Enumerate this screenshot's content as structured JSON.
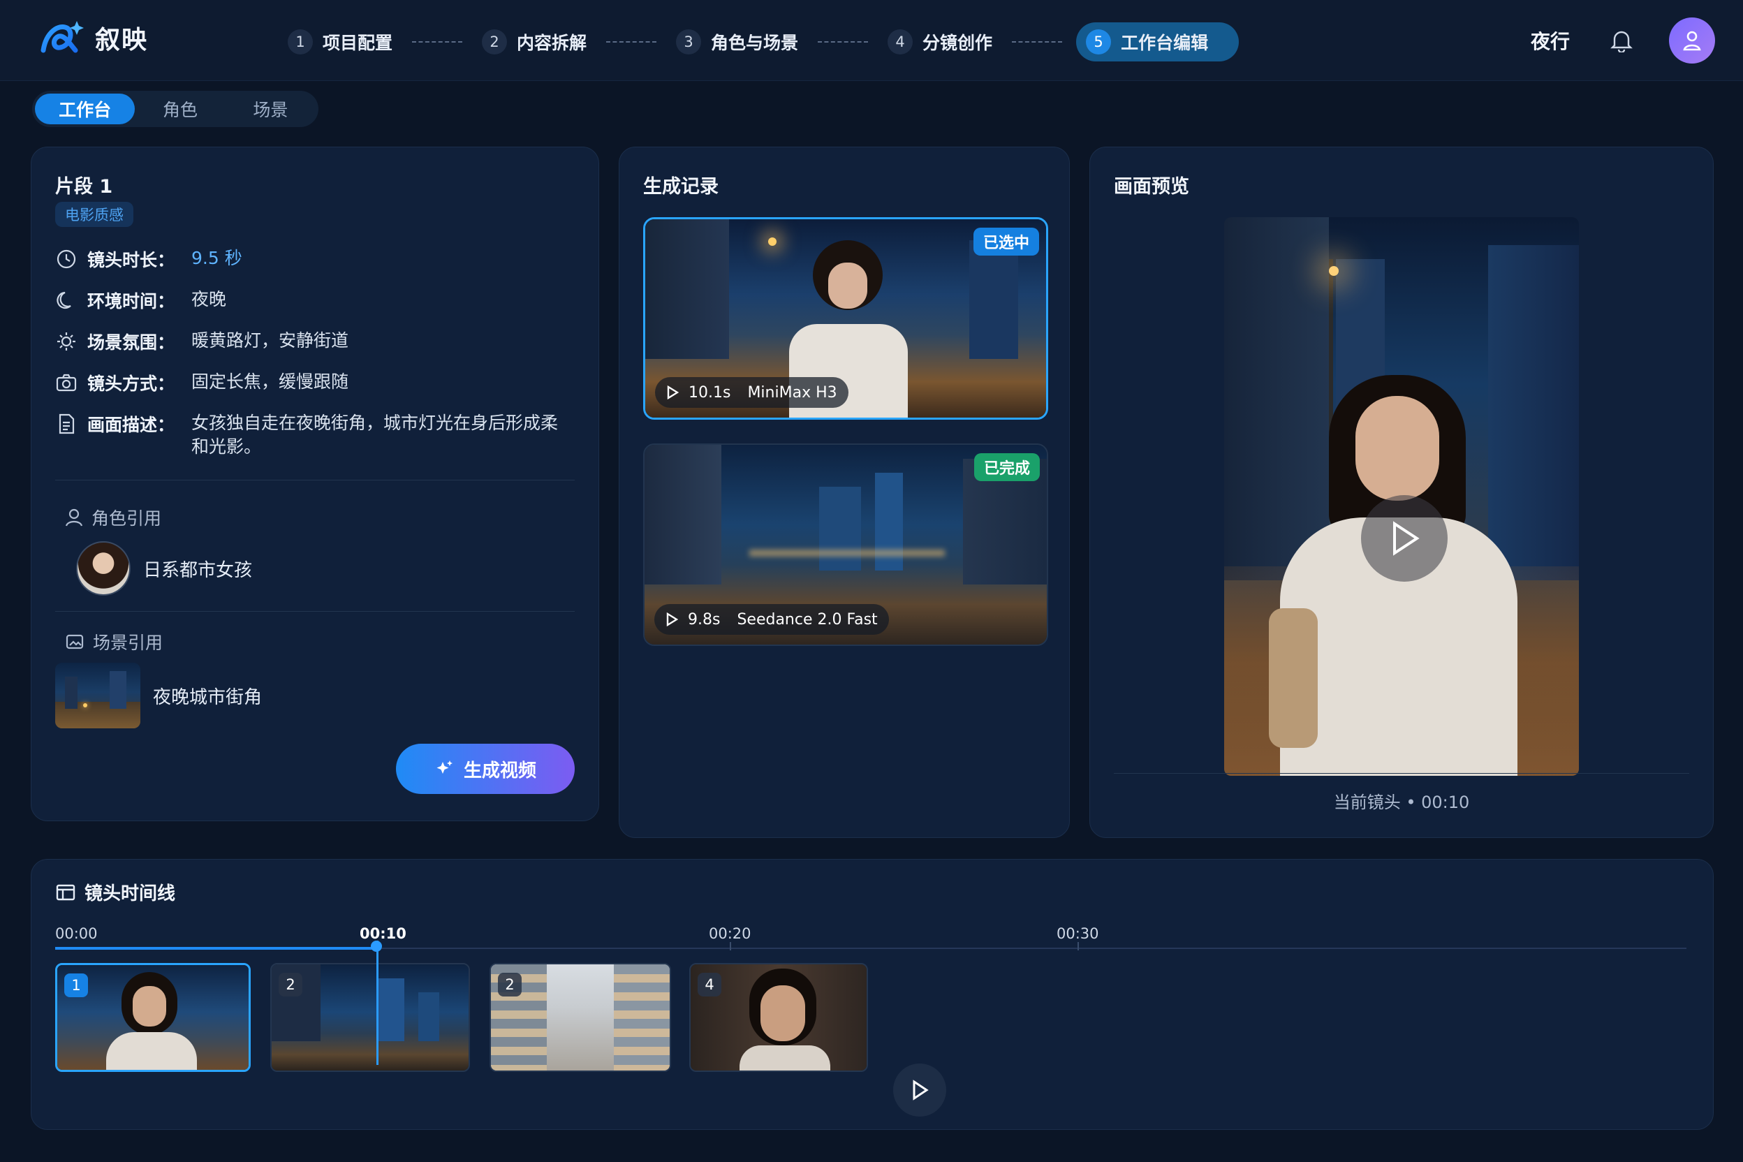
{
  "app": {
    "brand": "叙映"
  },
  "steps": [
    {
      "num": "1",
      "label": "项目配置"
    },
    {
      "num": "2",
      "label": "内容拆解"
    },
    {
      "num": "3",
      "label": "角色与场景"
    },
    {
      "num": "4",
      "label": "分镜创作"
    },
    {
      "num": "5",
      "label": "工作台编辑",
      "active": true
    }
  ],
  "header": {
    "mode_label": "夜行"
  },
  "subtabs": [
    "工作台",
    "角色",
    "场景"
  ],
  "segment": {
    "title": "片段 1",
    "tag": "电影质感",
    "rows": [
      {
        "key": "镜头时长：",
        "value": "9.5 秒",
        "icon": "clock-icon"
      },
      {
        "key": "环境时间：",
        "value": "夜晚",
        "icon": "moon-icon"
      },
      {
        "key": "场景氛围：",
        "value": "暖黄路灯，安静街道",
        "icon": "sun-icon"
      },
      {
        "key": "镜头方式：",
        "value": "固定长焦，缓慢跟随",
        "icon": "camera-icon"
      },
      {
        "key": "画面描述：",
        "value": "女孩独自走在夜晚街角，城市灯光在身后形成柔和光影。",
        "icon": "document-icon"
      }
    ],
    "character_ref_title": "角色引用",
    "character_name": "日系都市女孩",
    "scene_ref_title": "场景引用",
    "scene_name": "夜晚城市街角",
    "generate_button": "生成视频"
  },
  "records": {
    "title": "生成记录",
    "items": [
      {
        "badge": "已选中",
        "duration": "10.1s",
        "model": "MiniMax H3"
      },
      {
        "badge": "已完成",
        "duration": "9.8s",
        "model": "Seedance 2.0 Fast"
      }
    ]
  },
  "preview": {
    "title": "画面预览",
    "caption": "当前镜头 • 00:10"
  },
  "timeline": {
    "title": "镜头时间线",
    "ticks": [
      "00:00",
      "00:10",
      "00:20",
      "00:30"
    ],
    "clips": [
      "1",
      "2",
      "2",
      "4"
    ]
  },
  "colors": {
    "accent": "#1f8bf5",
    "selected_badge": "#1580e0",
    "completed_badge": "#1aa16a",
    "background": "#0b1526",
    "panel": "#10203a"
  }
}
